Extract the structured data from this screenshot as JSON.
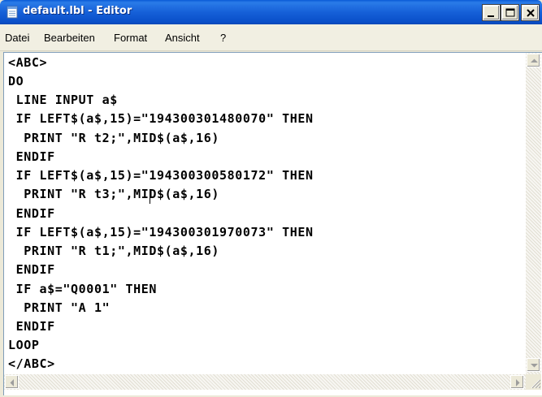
{
  "window": {
    "title": "default.lbl - Editor",
    "controls": {
      "minimize": "minimize",
      "maximize": "maximize",
      "close": "close"
    }
  },
  "menu": {
    "items": [
      "Datei",
      "Bearbeiten",
      "Format",
      "Ansicht",
      "?"
    ]
  },
  "editor": {
    "lines": [
      "<ABC>",
      "DO",
      " LINE INPUT a$",
      " IF LEFT$(a$,15)=\"194300301480070\" THEN",
      "  PRINT \"R t2;\",MID$(a$,16)",
      " ENDIF",
      " IF LEFT$(a$,15)=\"194300300580172\" THEN",
      "  PRINT \"R t3;\",MID$(a$,16)",
      " ENDIF",
      " IF LEFT$(a$,15)=\"194300301970073\" THEN",
      "  PRINT \"R t1;\",MID$(a$,16)",
      " ENDIF",
      " IF a$=\"Q0001\" THEN",
      "  PRINT \"A 1\"",
      " ENDIF",
      "LOOP",
      "</ABC>"
    ],
    "caret_line": 8
  },
  "colors": {
    "titlebar": "#0a5bd6",
    "window_bg": "#ece9d8",
    "editor_bg": "#ffffff",
    "text": "#000000"
  }
}
